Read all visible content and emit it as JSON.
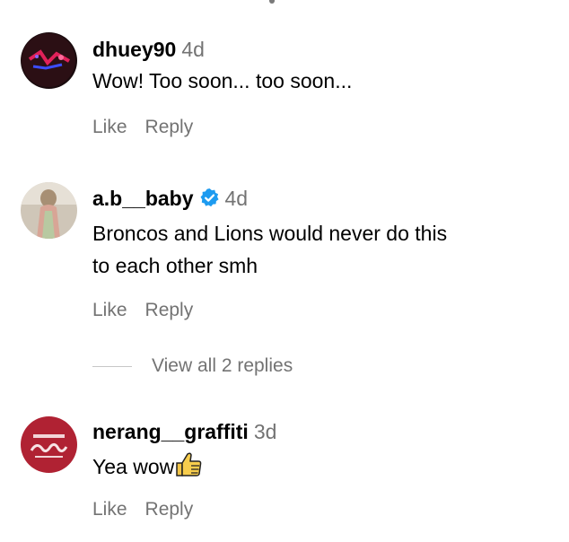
{
  "comments": [
    {
      "username": "dhuey90",
      "time": "4d",
      "text": "Wow! Too soon... too soon...",
      "like_label": "Like",
      "reply_label": "Reply",
      "verified": false,
      "avatar_icon": "avatar-neon-sign"
    },
    {
      "username": "a.b__baby",
      "time": "4d",
      "text_lines": [
        "Broncos and Lions would never do this",
        "to each other smh"
      ],
      "like_label": "Like",
      "reply_label": "Reply",
      "verified": true,
      "verified_color": "#1d9bf0",
      "avatar_icon": "avatar-person-photo"
    },
    {
      "username": "nerang__graffiti",
      "time": "3d",
      "text": "Yea wow",
      "emoji": "thumbs-up-icon",
      "like_label": "Like",
      "reply_label": "Reply",
      "verified": false,
      "avatar_icon": "avatar-graffiti-logo"
    }
  ],
  "view_replies": {
    "label": "View all 2 replies"
  }
}
